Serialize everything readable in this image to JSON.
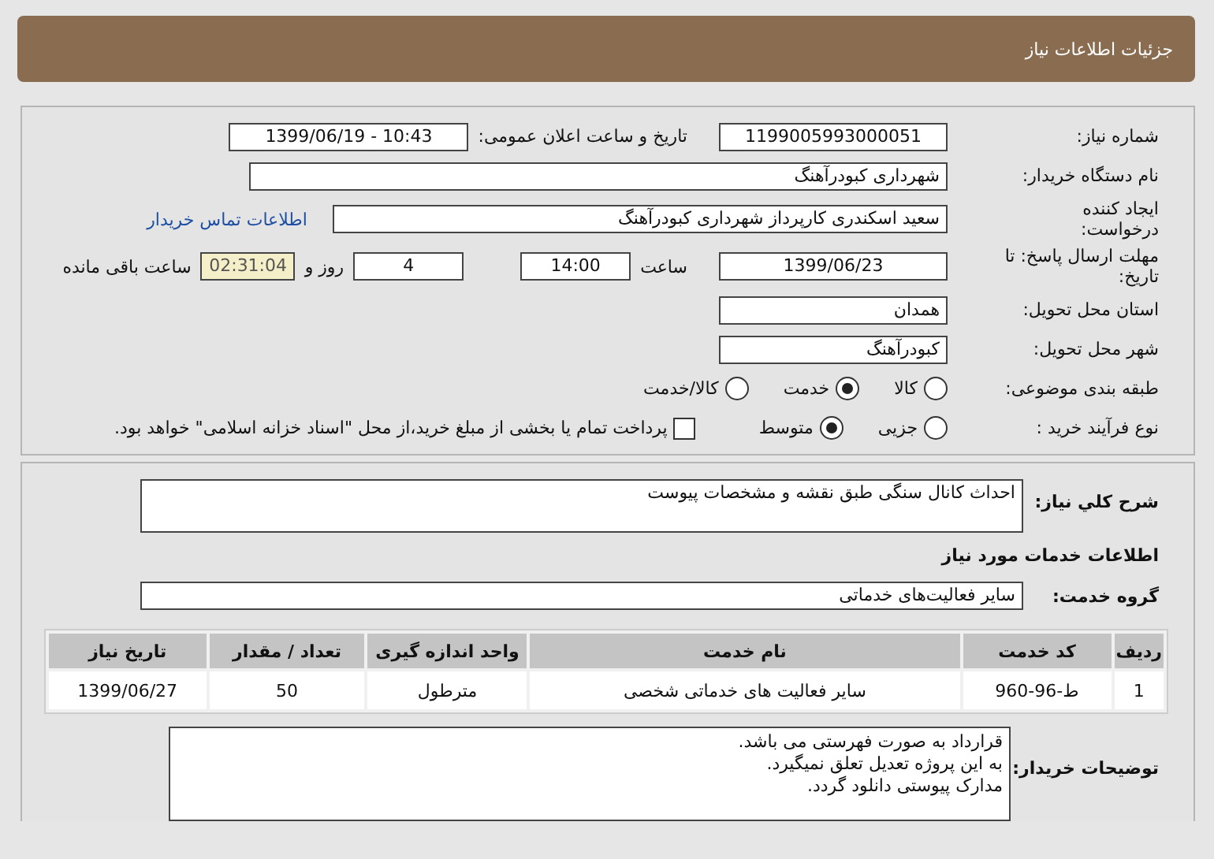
{
  "header": {
    "title": "جزئیات اطلاعات نیاز"
  },
  "need_number": {
    "label": "شماره نیاز:",
    "value": "1199005993000051"
  },
  "announce_datetime": {
    "label": "تاریخ و ساعت اعلان عمومی:",
    "value": "1399/06/19 - 10:43"
  },
  "buyer_org": {
    "label": "نام دستگاه خریدار:",
    "value": "شهرداری کبودرآهنگ"
  },
  "requester": {
    "label": "ایجاد کننده درخواست:",
    "value": "سعید اسکندری کارپرداز شهرداری کبودرآهنگ",
    "contact_link": "اطلاعات تماس خریدار"
  },
  "deadline": {
    "label": "مهلت ارسال پاسخ: تا تاریخ:",
    "date": "1399/06/23",
    "time_label": "ساعت",
    "time": "14:00",
    "days": "4",
    "days_label": "روز و",
    "remaining": "02:31:04",
    "remaining_label": "ساعت باقی مانده"
  },
  "delivery_province": {
    "label": "استان محل تحویل:",
    "value": "همدان"
  },
  "delivery_city": {
    "label": "شهر محل تحویل:",
    "value": "کبودرآهنگ"
  },
  "category": {
    "label": "طبقه بندی موضوعی:",
    "options": [
      {
        "label": "کالا",
        "selected": false
      },
      {
        "label": "خدمت",
        "selected": true
      },
      {
        "label": "کالا/خدمت",
        "selected": false
      }
    ]
  },
  "purchase_process": {
    "label": "نوع فرآیند خرید :",
    "options": [
      {
        "label": "جزیی",
        "selected": false
      },
      {
        "label": "متوسط",
        "selected": true
      }
    ],
    "treasury_payment": {
      "label": "پرداخت تمام یا بخشی از مبلغ خرید،از محل \"اسناد خزانه اسلامی\" خواهد بود.",
      "checked": false
    }
  },
  "description": {
    "label": "شرح کلي نیاز:",
    "value": "احداث کانال سنگی طبق نقشه و مشخصات پیوست"
  },
  "services_heading": "اطلاعات خدمات مورد نیاز",
  "service_group": {
    "label": "گروه خدمت:",
    "value": "سایر فعالیت‌های خدماتی"
  },
  "table": {
    "columns": [
      "ردیف",
      "کد خدمت",
      "نام خدمت",
      "واحد اندازه گیری",
      "تعداد / مقدار",
      "تاریخ نیاز"
    ],
    "rows": [
      [
        "1",
        "ط-96-960",
        "سایر فعالیت های خدماتی شخصی",
        "مترطول",
        "50",
        "1399/06/27"
      ]
    ]
  },
  "buyer_notes": {
    "label": "توضیحات خریدار:",
    "lines": [
      "قرارداد به صورت فهرستی می باشد.",
      "به این پروژه تعدیل تعلق نمیگیرد.",
      "مدارک پیوستی دانلود گردد."
    ]
  }
}
